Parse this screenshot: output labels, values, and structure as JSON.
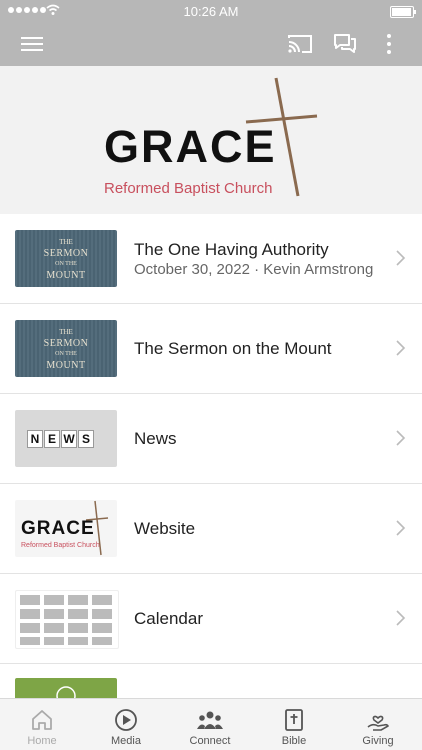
{
  "status_bar": {
    "time": "10:26 AM"
  },
  "toolbar": {
    "menu_icon": "hamburger-icon",
    "cast_icon": "cast-icon",
    "chat_icon": "chat-icon",
    "more_icon": "more-vertical-icon"
  },
  "hero": {
    "logo_word": "GRACE",
    "logo_sub": "Reformed Baptist Church"
  },
  "items": [
    {
      "title": "The One Having Authority",
      "subtitle": "October 30, 2022 · Kevin Armstrong",
      "thumb": "sermon"
    },
    {
      "title": "The Sermon on the Mount",
      "thumb": "sermon"
    },
    {
      "title": "News",
      "thumb": "news"
    },
    {
      "title": "Website",
      "thumb": "website"
    },
    {
      "title": "Calendar",
      "thumb": "calendar"
    }
  ],
  "sermon_thumb": {
    "line1": "THE",
    "line2": "SERMON",
    "line3": "ON THE",
    "line4": "MOUNT"
  },
  "news_thumb": {
    "letters": [
      "N",
      "E",
      "W",
      "S"
    ]
  },
  "website_thumb": {
    "word": "GRACE",
    "sub": "Reformed Baptist Church"
  },
  "tabs": [
    {
      "label": "Home",
      "icon": "home-icon",
      "active": true
    },
    {
      "label": "Media",
      "icon": "play-icon"
    },
    {
      "label": "Connect",
      "icon": "people-icon"
    },
    {
      "label": "Bible",
      "icon": "bible-icon"
    },
    {
      "label": "Giving",
      "icon": "giving-hand-icon"
    }
  ],
  "colors": {
    "bar": "#b7b7b7",
    "accent": "#c8505e",
    "cross": "#8a6a4f"
  }
}
